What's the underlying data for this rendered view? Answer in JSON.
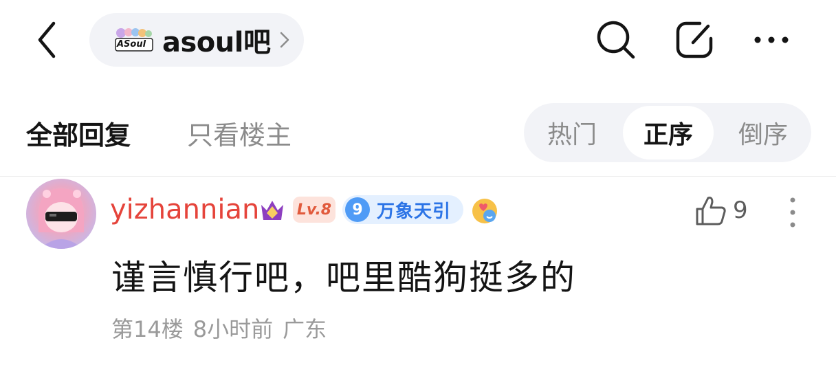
{
  "header": {
    "forum_name": "asoul吧",
    "forum_logo_text": "ASoul",
    "icons": {
      "back": "back-arrow-icon",
      "search": "search-icon",
      "edit": "edit-icon",
      "more": "more-icon"
    }
  },
  "filters": {
    "tabs": [
      {
        "label": "全部回复",
        "active": true
      },
      {
        "label": "只看楼主",
        "active": false
      }
    ],
    "sort": [
      {
        "label": "热门",
        "active": false
      },
      {
        "label": "正序",
        "active": true
      },
      {
        "label": "倒序",
        "active": false
      }
    ]
  },
  "reply": {
    "username": "yizhannian",
    "username_color": "#e5443b",
    "level": "Lv.8",
    "title_level": "9",
    "title_text": "万象天引",
    "content": "谨言慎行吧，吧里酷狗挺多的",
    "floor": "第14楼",
    "time": "8小时前",
    "location": "广东",
    "like_count": "9"
  }
}
